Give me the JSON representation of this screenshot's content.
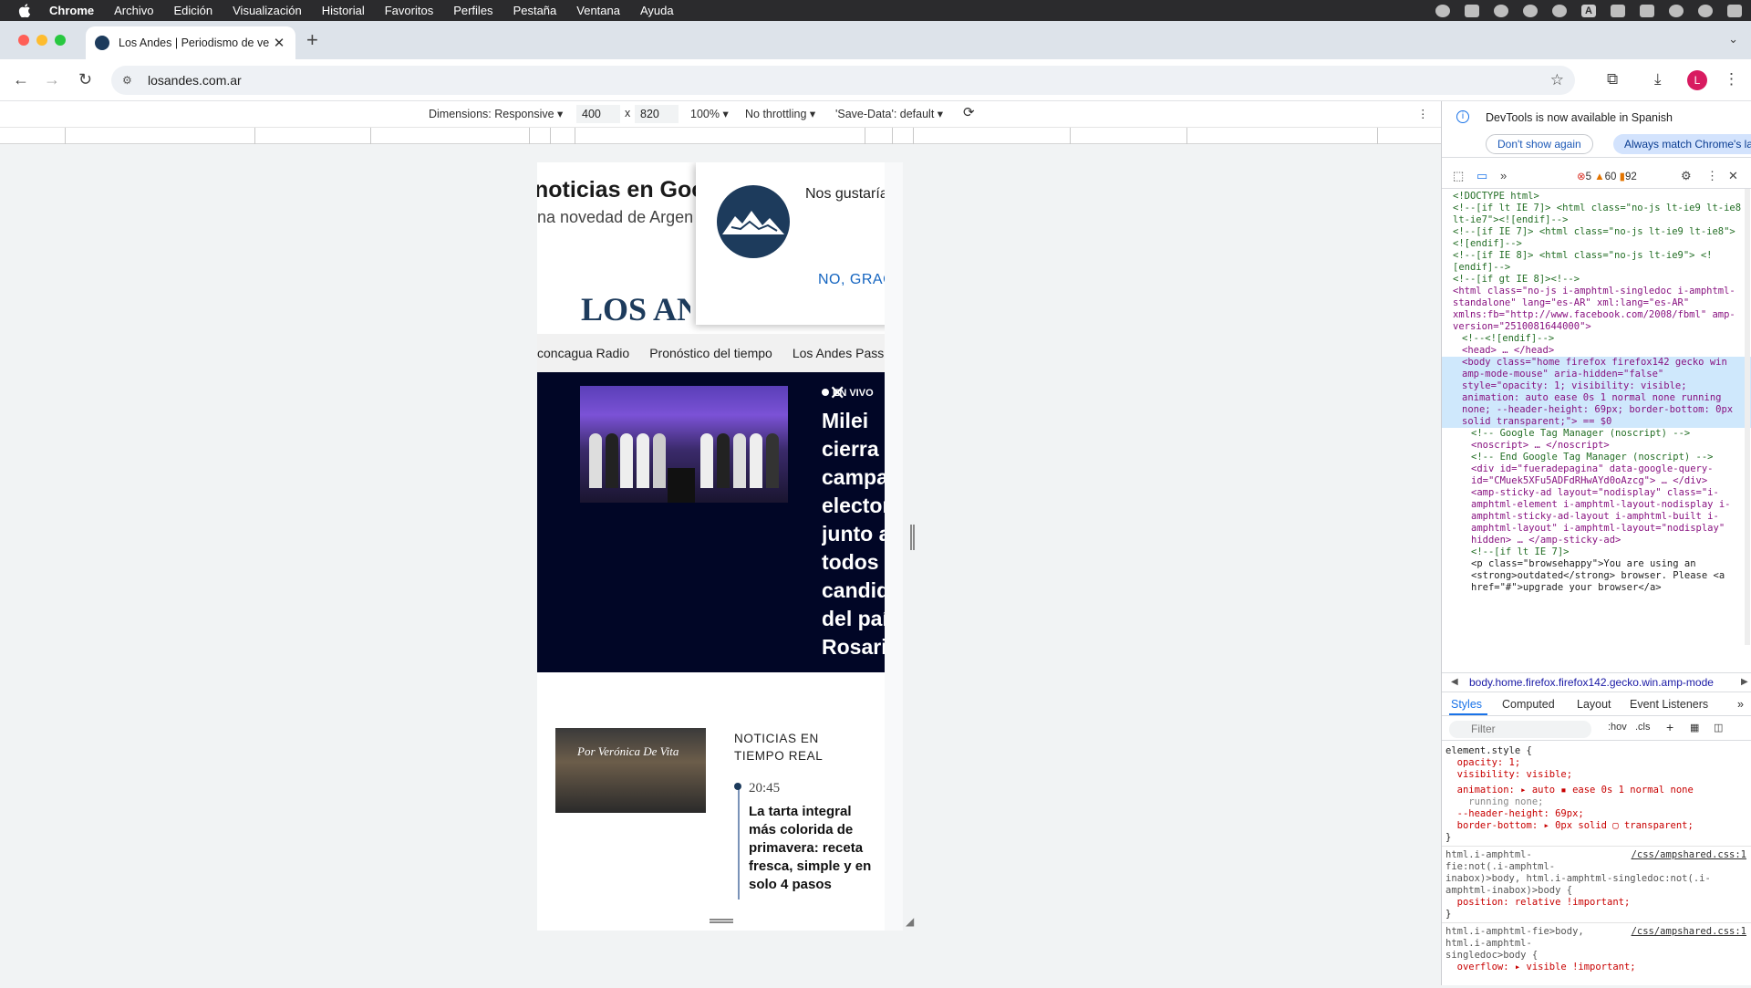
{
  "menubar": {
    "app": "Chrome",
    "items": [
      "Archivo",
      "Edición",
      "Visualización",
      "Historial",
      "Favoritos",
      "Perfiles",
      "Pestaña",
      "Ventana",
      "Ayuda"
    ],
    "tray_letter": "A"
  },
  "tab": {
    "title": "Los Andes | Periodismo de ve"
  },
  "omnibox": {
    "url": "losandes.com.ar"
  },
  "profile_initial": "L",
  "device_toolbar": {
    "dimensions": "Dimensions: Responsive",
    "width": "400",
    "times": "x",
    "height": "820",
    "zoom": "100%",
    "throttling": "No throttling",
    "save_data": "'Save-Data': default"
  },
  "page": {
    "google_banner": {
      "line1": "noticias en Goo",
      "line2": "na novedad de Argen"
    },
    "logo": "LOS ANDES",
    "popup": {
      "message": "Nos gustaría m",
      "decline": "NO, GRACIAS"
    },
    "nav_links": [
      "concagua Radio",
      "Pronóstico del tiempo",
      "Los Andes Pass"
    ],
    "hero": {
      "live": "EN VIVO",
      "headline_lines": [
        "Milei",
        "cierra la",
        "campaña",
        "electoral",
        "junto a",
        "todos los",
        "candidatos",
        "del país",
        "Rosario"
      ]
    },
    "story": {
      "byline": "Por Verónica De Vita"
    },
    "realtime": {
      "title": "NOTICIAS EN TIEMPO REAL",
      "time": "20:45",
      "headline": "La tarta integral más colorida de primavera: receta fresca, simple y en solo 4 pasos"
    }
  },
  "devtools": {
    "notice": {
      "text": "DevTools is now available in Spanish",
      "dismiss": "Don't show again",
      "match": "Always match Chrome's la"
    },
    "counts": {
      "errors": "5",
      "warnings": "60",
      "info": "92"
    },
    "dom_lines": [
      "<!DOCTYPE html>",
      "<!--[if lt IE 7]>  <html class=\"no-js lt-ie9 lt-ie8 lt-ie7\"><![endif]-->",
      "<!--[if IE 7]>  <html class=\"no-js lt-ie9 lt-ie8\"> <![endif]-->",
      "<!--[if IE 8]>  <html class=\"no-js lt-ie9\"> <![endif]-->",
      "<!--[if gt IE 8]><!-->",
      "<html class=\"no-js i-amphtml-singledoc i-amphtml-standalone\" lang=\"es-AR\" xml:lang=\"es-AR\" xmlns:fb=\"http://www.facebook.com/2008/fbml\" amp-version=\"2510081644000\">",
      "<!--<![endif]-->",
      "<head> … </head>",
      "<body class=\"home firefox firefox142 gecko win amp-mode-mouse\" aria-hidden=\"false\" style=\"opacity: 1; visibility: visible; animation: auto ease 0s 1 normal none running none; --header-height: 69px; border-bottom: 0px solid transparent;\"> == $0",
      "<!-- Google Tag Manager (noscript) -->",
      "<noscript> … </noscript>",
      "<!-- End Google Tag Manager (noscript) -->",
      "<div id=\"fueradepagina\" data-google-query-id=\"CMuek5XFu5ADFdRHwAYd0oAzcg\"> … </div>",
      "<amp-sticky-ad layout=\"nodisplay\" class=\"i-amphtml-element i-amphtml-layout-nodisplay i-amphtml-sticky-ad-layout i-amphtml-built i-amphtml-layout\" i-amphtml-layout=\"nodisplay\" hidden> … </amp-sticky-ad>",
      "<!--[if lt IE 7]>",
      "<p class=\"browsehappy\">You are using an <strong>outdated</strong> browser. Please <a href=\"#\">upgrade your browser</a>"
    ],
    "breadcrumb": "body.home.firefox.firefox142.gecko.win.amp-mode",
    "tabs": [
      "Styles",
      "Computed",
      "Layout",
      "Event Listeners"
    ],
    "filter_placeholder": "Filter",
    "filter_hov": ":hov",
    "filter_cls": ".cls",
    "styles_lines": [
      "element.style {",
      "  opacity: 1;",
      "  visibility: visible;",
      "  animation: ▸ auto ▪ ease 0s 1 normal none",
      "    running none;",
      "  --header-height: 69px;",
      "  border-bottom: ▸ 0px solid ▢ transparent;",
      "}",
      "html.i-amphtml-",
      "fie:not(.i-amphtml-",
      "inabox)>body, html.i-amphtml-singledoc:not(.i-",
      "amphtml-inabox)>body {",
      "  position: relative !important;",
      "}",
      "html.i-amphtml-fie>body,",
      "html.i-amphtml-",
      "singledoc>body {",
      "  overflow: ▸ visible !important;"
    ],
    "style_sources": [
      "/css/ampshared.css:1",
      "/css/ampshared.css:1"
    ]
  }
}
